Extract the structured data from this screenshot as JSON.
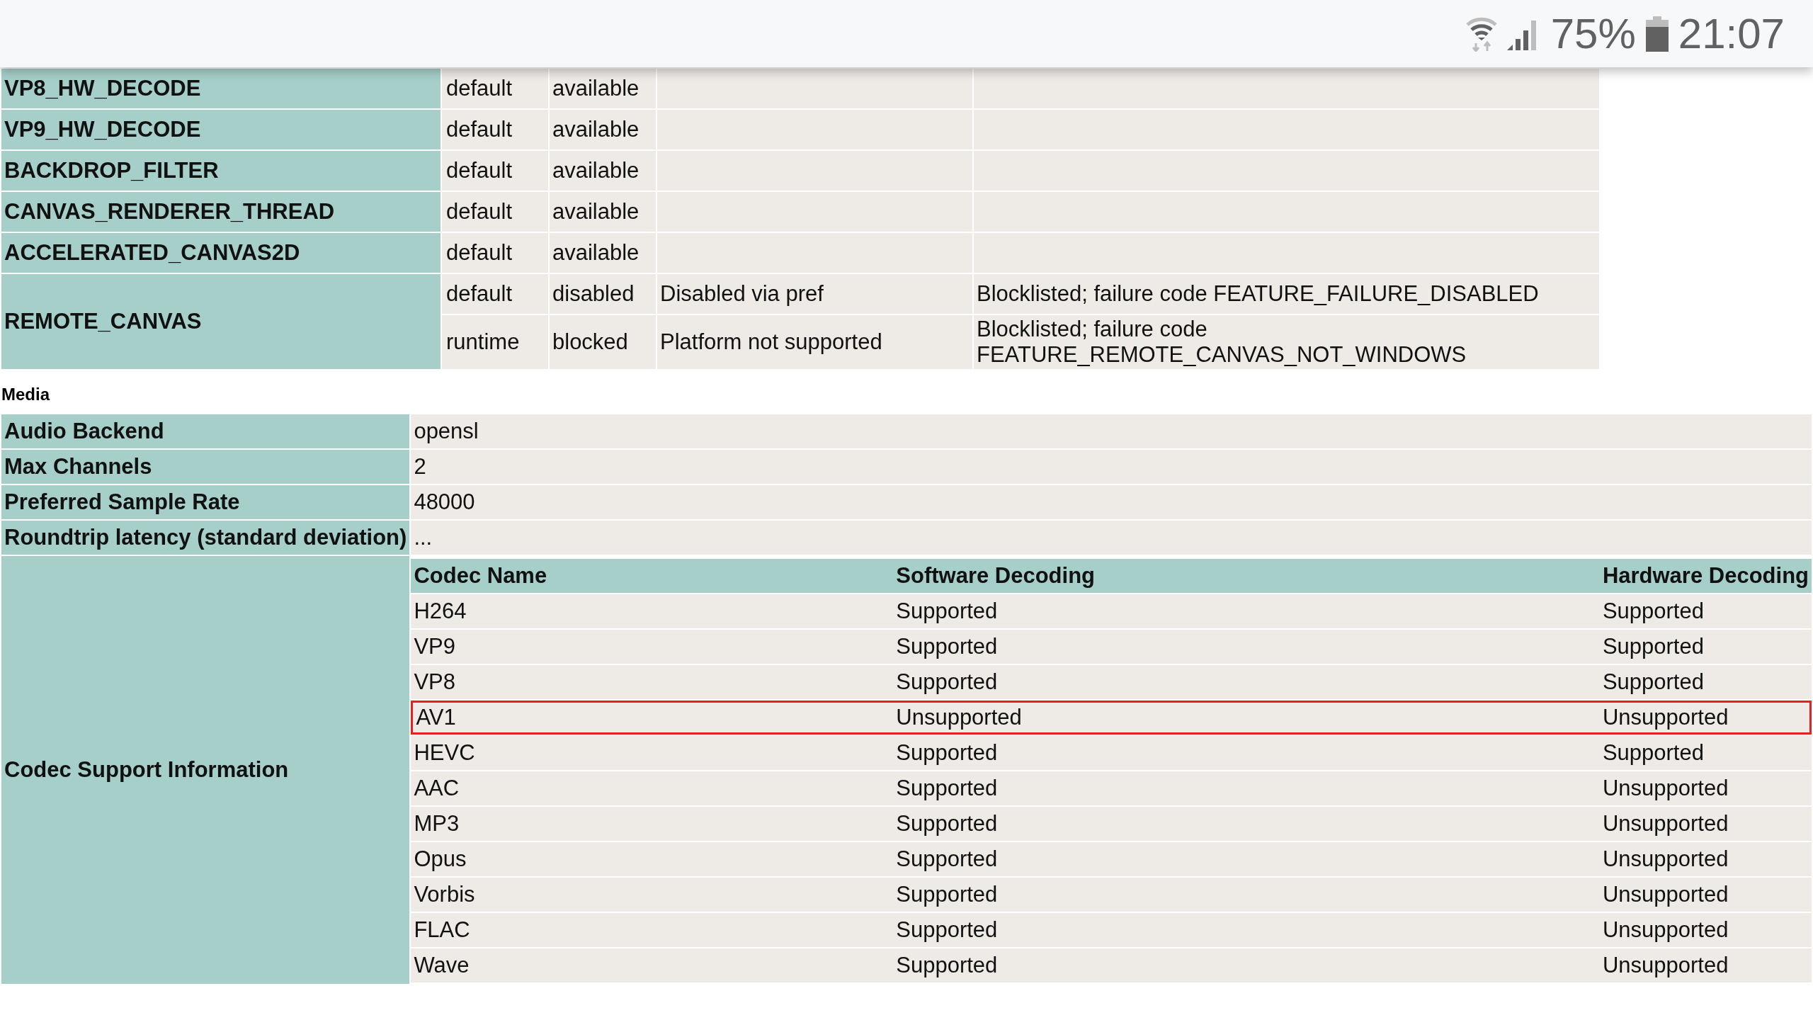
{
  "status_bar": {
    "battery": "75%",
    "time": "21:07"
  },
  "features": [
    {
      "name": "VP8_HW_DECODE",
      "entries": [
        {
          "source": "default",
          "status": "available"
        }
      ]
    },
    {
      "name": "VP9_HW_DECODE",
      "entries": [
        {
          "source": "default",
          "status": "available"
        }
      ]
    },
    {
      "name": "BACKDROP_FILTER",
      "entries": [
        {
          "source": "default",
          "status": "available"
        }
      ]
    },
    {
      "name": "CANVAS_RENDERER_THREAD",
      "entries": [
        {
          "source": "default",
          "status": "available"
        }
      ]
    },
    {
      "name": "ACCELERATED_CANVAS2D",
      "entries": [
        {
          "source": "default",
          "status": "available"
        }
      ]
    },
    {
      "name": "REMOTE_CANVAS",
      "entries": [
        {
          "source": "default",
          "status": "disabled",
          "message": "Disabled via pref",
          "failure": "Blocklisted; failure code FEATURE_FAILURE_DISABLED"
        },
        {
          "source": "runtime",
          "status": "blocked",
          "message": "Platform not supported",
          "failure": "Blocklisted; failure code FEATURE_REMOTE_CANVAS_NOT_WINDOWS"
        }
      ]
    }
  ],
  "media": {
    "heading": "Media",
    "rows": [
      {
        "label": "Audio Backend",
        "value": "opensl"
      },
      {
        "label": "Max Channels",
        "value": "2"
      },
      {
        "label": "Preferred Sample Rate",
        "value": "48000"
      },
      {
        "label": "Roundtrip latency (standard deviation)",
        "value": "..."
      }
    ],
    "codecs": {
      "label": "Codec Support Information",
      "columns": [
        "Codec Name",
        "Software Decoding",
        "Hardware Decoding"
      ],
      "rows": [
        {
          "cells": [
            "H264",
            "Supported",
            "Supported"
          ],
          "highlighted": false
        },
        {
          "cells": [
            "VP9",
            "Supported",
            "Supported"
          ],
          "highlighted": false
        },
        {
          "cells": [
            "VP8",
            "Supported",
            "Supported"
          ],
          "highlighted": false
        },
        {
          "cells": [
            "AV1",
            "Unsupported",
            "Unsupported"
          ],
          "highlighted": true
        },
        {
          "cells": [
            "HEVC",
            "Supported",
            "Supported"
          ],
          "highlighted": false
        },
        {
          "cells": [
            "AAC",
            "Supported",
            "Unsupported"
          ],
          "highlighted": false
        },
        {
          "cells": [
            "MP3",
            "Supported",
            "Unsupported"
          ],
          "highlighted": false
        },
        {
          "cells": [
            "Opus",
            "Supported",
            "Unsupported"
          ],
          "highlighted": false
        },
        {
          "cells": [
            "Vorbis",
            "Supported",
            "Unsupported"
          ],
          "highlighted": false
        },
        {
          "cells": [
            "FLAC",
            "Supported",
            "Unsupported"
          ],
          "highlighted": false
        },
        {
          "cells": [
            "Wave",
            "Supported",
            "Unsupported"
          ],
          "highlighted": false
        }
      ]
    }
  }
}
